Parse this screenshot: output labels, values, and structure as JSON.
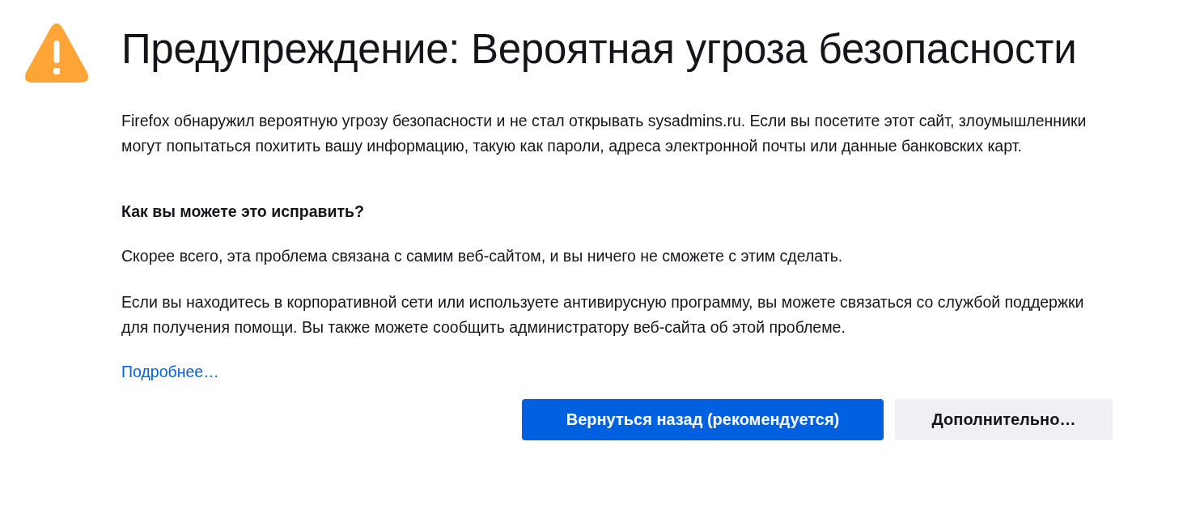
{
  "title": "Предупреждение: Вероятная угроза безопасности",
  "intro": "Firefox обнаружил вероятную угрозу безопасности и не стал открывать sysadmins.ru. Если вы посетите этот сайт, злоумышленники могут попытаться похитить вашу информацию, такую как пароли, адреса электронной почты или данные банковских карт.",
  "fix_heading": "Как вы можете это исправить?",
  "paragraphs": [
    "Скорее всего, эта проблема связана с самим веб-сайтом, и вы ничего не сможете с этим сделать.",
    "Если вы находитесь в корпоративной сети или используете антивирусную программу, вы можете связаться со службой поддержки для получения помощи. Вы также можете сообщить администратору веб-сайта об этой проблеме."
  ],
  "learn_more": "Подробнее…",
  "buttons": [
    {
      "label": "Вернуться назад (рекомендуется)",
      "kind": "primary"
    },
    {
      "label": "Дополнительно…",
      "kind": "secondary"
    }
  ]
}
